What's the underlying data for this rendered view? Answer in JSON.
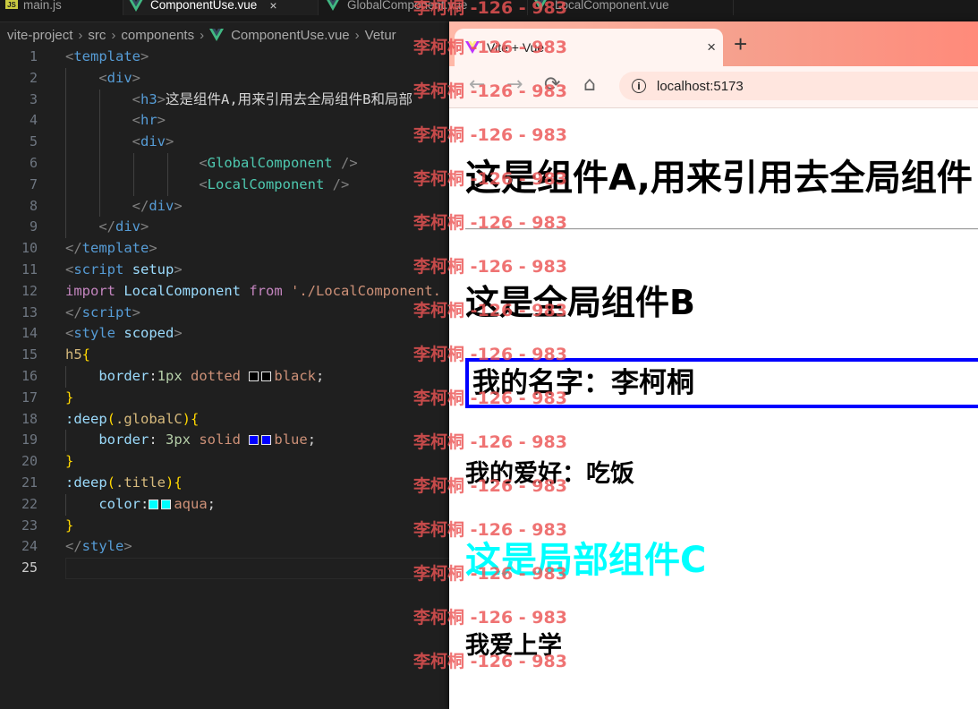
{
  "editor": {
    "tabs": [
      {
        "label": "main.js",
        "icon": "js-icon"
      },
      {
        "label": "ComponentUse.vue",
        "icon": "vue-icon",
        "active": true
      },
      {
        "label": "GlobalComponent.vue",
        "icon": "vue-icon"
      },
      {
        "label": "LocalComponent.vue",
        "icon": "vue-icon"
      }
    ],
    "breadcrumb": [
      "vite-project",
      "src",
      "components",
      "ComponentUse.vue",
      "Vetur"
    ],
    "line_numbers": [
      "1",
      "2",
      "3",
      "4",
      "5",
      "6",
      "7",
      "8",
      "9",
      "10",
      "11",
      "12",
      "13",
      "14",
      "15",
      "16",
      "17",
      "18",
      "19",
      "20",
      "21",
      "22",
      "23",
      "24",
      "25"
    ],
    "code": {
      "l1_tag": "template",
      "l2_tag": "div",
      "l3_tag": "h3",
      "l3_text": "这是组件A,用来引用去全局组件B和局部",
      "l4_tag": "hr",
      "l5_tag": "div",
      "l6_comp": "GlobalComponent",
      "l7_comp": "LocalComponent",
      "l8_tag": "div",
      "l9_tag": "div",
      "l10_tag": "template",
      "l11_tag": "script",
      "l11_attr": "setup",
      "l12_import": "import",
      "l12_id": "LocalComponent",
      "l12_from": "from",
      "l12_str": "'./LocalComponent.",
      "l13_tag": "script",
      "l14_tag": "style",
      "l14_attr": "scoped",
      "l15_sel": "h5",
      "l16_prop": "border",
      "l16_num": "1px",
      "l16_val1": "dotted",
      "l16_val2": "black",
      "l18_fn": ":deep",
      "l18_sel": ".globalC",
      "l19_prop": "border",
      "l19_num": "3px",
      "l19_val1": "solid",
      "l19_val2": "blue",
      "l21_fn": ":deep",
      "l21_sel": ".title",
      "l22_prop": "color",
      "l22_val": "aqua",
      "l24_tag": "style"
    },
    "swatch_colors": {
      "black": "#000000",
      "blue": "#0000ff",
      "aqua": "#00ffff"
    }
  },
  "browser": {
    "tab_title": "Vite + Vue",
    "close_glyph": "×",
    "new_tab_glyph": "+",
    "url": "localhost:5173",
    "page": {
      "h3": "这是组件A,用来引用去全局组件",
      "global_title": "这是全局组件B",
      "my_name": "我的名字：李柯桐",
      "my_hobby": "我的爱好：吃饭",
      "local_title": "这是局部组件C",
      "study": "我爱上学"
    },
    "colors": {
      "globalC_border": "#0000ff",
      "title_color": "#00ffff"
    }
  },
  "watermark": "李柯桐 -126 - 983"
}
